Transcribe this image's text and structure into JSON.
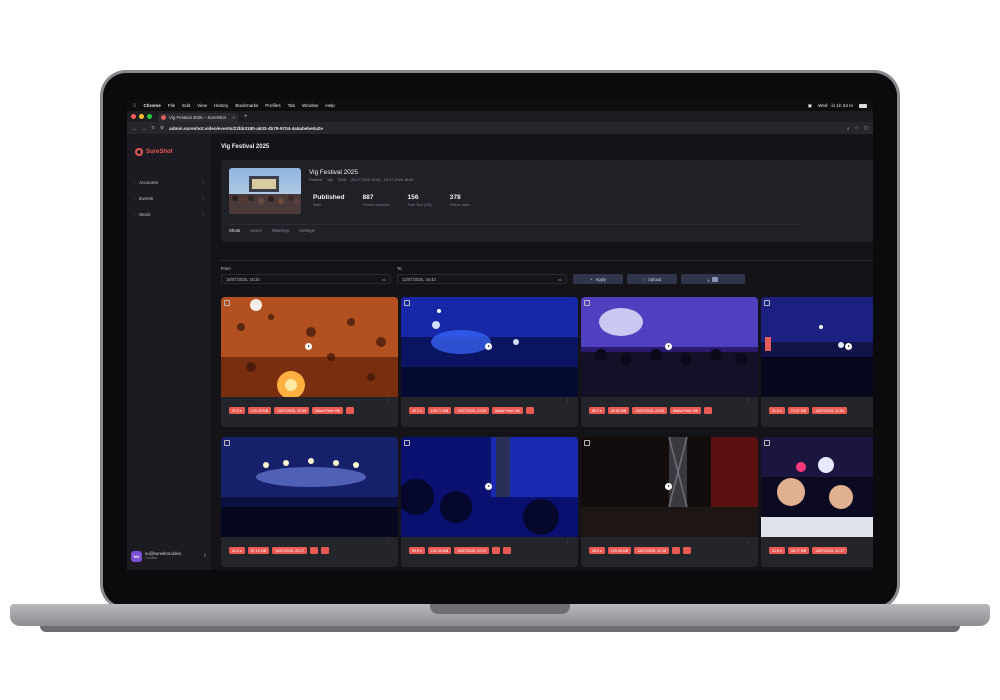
{
  "menubar": {
    "app": "Chrome",
    "items": [
      "File",
      "Edit",
      "View",
      "History",
      "Bookmarks",
      "Profiles",
      "Tab",
      "Window",
      "Help"
    ],
    "status": "Wed · in 1h 34 m"
  },
  "browser": {
    "tab_title": "Vig Festival 2025 – SureShot",
    "url": "admin.sureshot.video/events/22bb3180-a633-4b78-9704-4a5abebe0a2e",
    "colors": {
      "close": "#ff5f57",
      "minimize": "#febc2e",
      "zoom": "#28c840"
    }
  },
  "sidebar": {
    "logo": "SureShot",
    "items": [
      {
        "label": "Accounts",
        "icon": "accounts-icon"
      },
      {
        "label": "Events",
        "icon": "events-icon"
      },
      {
        "label": "Stock",
        "icon": "stock-icon"
      }
    ],
    "user": {
      "initials": "NU",
      "email": "nu@sureshot.video",
      "role": "Creator"
    }
  },
  "page": {
    "title": "Vig Festival 2025"
  },
  "event": {
    "name": "Vig Festival 2025",
    "meta": [
      "Festival",
      "Vig",
      "2025",
      "28.07.2025 16:40 - 13.07.2026 16:40"
    ],
    "stats": [
      {
        "value": "Published",
        "label": "State"
      },
      {
        "value": "887",
        "label": "Photos uploaded"
      },
      {
        "value": "156",
        "label": "Total Size (GB)"
      },
      {
        "value": "378",
        "label": "Videos taken"
      }
    ],
    "tabs": [
      "Shots",
      "Users",
      "Sharings",
      "Settings"
    ]
  },
  "filter": {
    "from_label": "From",
    "from_value": "18/07/2025, 15:34",
    "to_label": "To",
    "to_value": "13/07/2026, 16:43",
    "apply": "Apply",
    "upload": "Upload",
    "download_icon": "download-icon"
  },
  "shots": [
    {
      "tags": [
        "37.0 s",
        "125.43 MB",
        "13/07/2025, 22:55",
        "Maria Peter Vilt"
      ]
    },
    {
      "tags": [
        "42.1 s",
        "108.77 MB",
        "13/07/2025, 22:54",
        "Maria Peter Vilt"
      ]
    },
    {
      "tags": [
        "56.2 s",
        "89.90 MB",
        "13/07/2025, 22:53",
        "Maria Peter Vilt"
      ]
    },
    {
      "tags": [
        "31.5 s",
        "70.07 MB",
        "13/07/2025, 22:52"
      ]
    },
    {
      "tags": [
        "41.0 s",
        "87.12 MB",
        "13/07/2025, 22:27"
      ]
    },
    {
      "tags": [
        "39.0 s",
        "101.53 MB",
        "13/07/2025, 22:21"
      ]
    },
    {
      "tags": [
        "36.4 s",
        "109.08 MB",
        "13/07/2025, 22:18"
      ]
    },
    {
      "tags": [
        "31.6 s",
        "98.77 MB",
        "13/07/2025, 22:17"
      ]
    }
  ]
}
